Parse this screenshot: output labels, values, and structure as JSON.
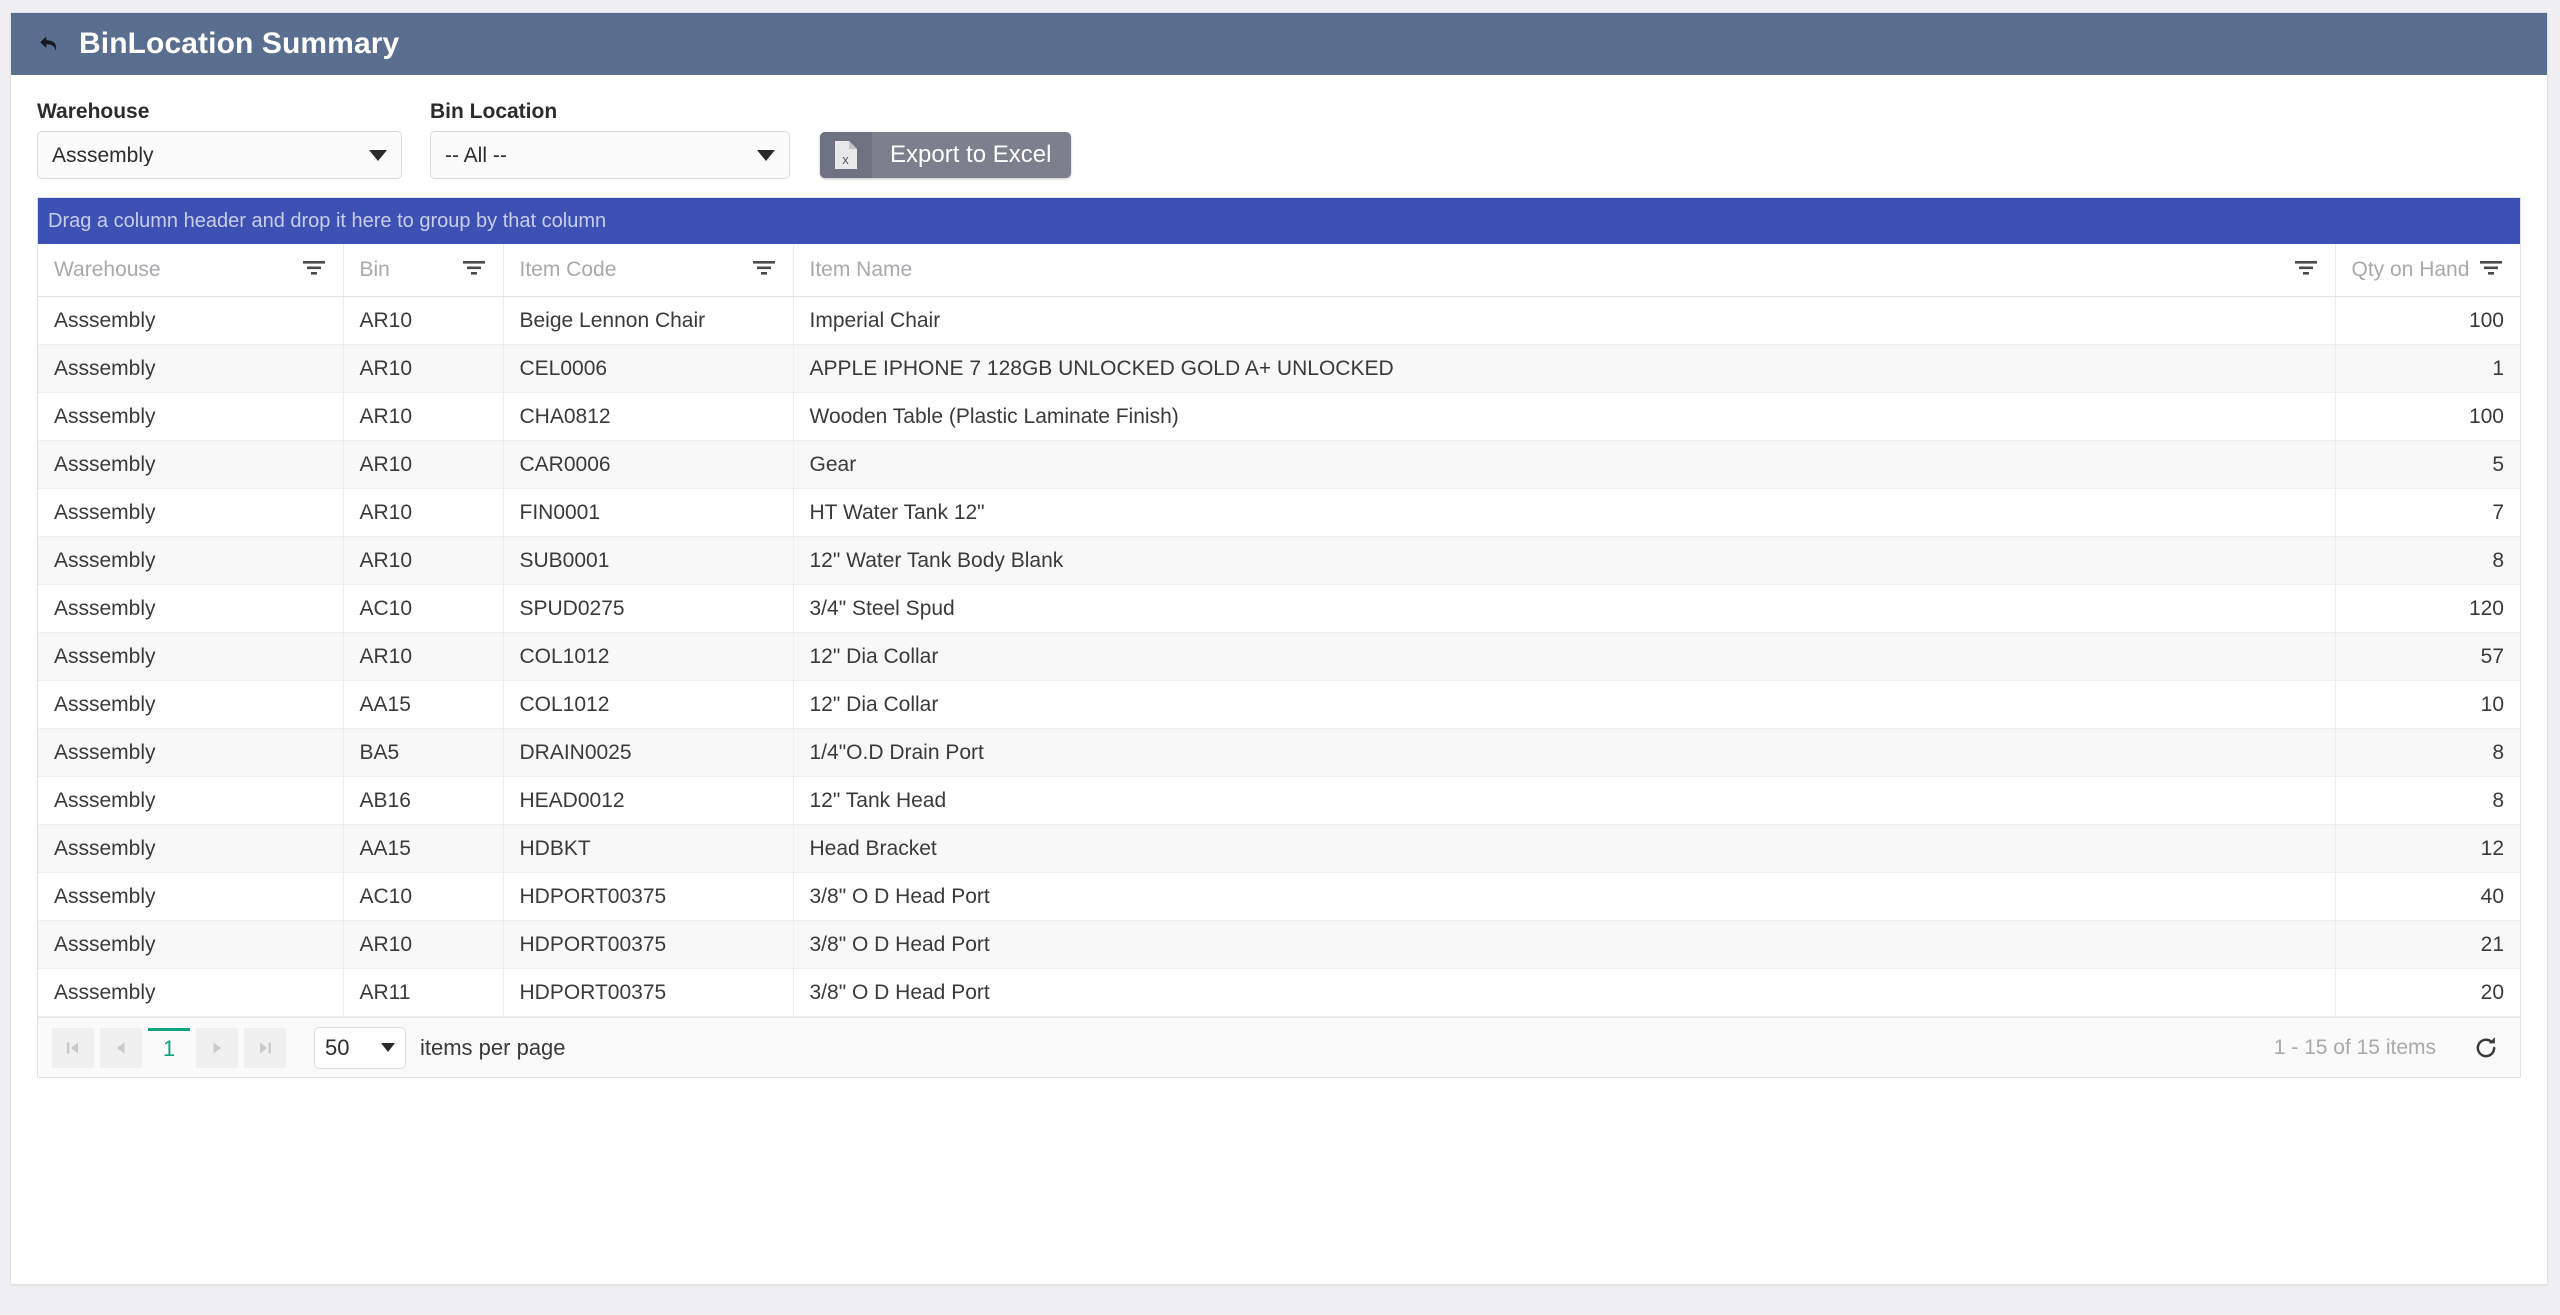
{
  "header": {
    "title": "BinLocation Summary",
    "back_icon": "back-arrow-icon",
    "bg_color": "#5a6e8f"
  },
  "toolbar": {
    "warehouse_label": "Warehouse",
    "warehouse_value": "Asssembly",
    "binlocation_label": "Bin Location",
    "binlocation_value": "-- All --",
    "export_label": "Export to Excel",
    "export_icon": "excel-file-icon",
    "export_bg_color": "#7c7f8c"
  },
  "grid": {
    "group_bar_text": "Drag a column header and drop it here to group by that column",
    "group_bar_color": "#3d51b5",
    "columns": [
      {
        "label": "Warehouse",
        "align": "left",
        "filter": true
      },
      {
        "label": "Bin",
        "align": "left",
        "filter": true
      },
      {
        "label": "Item Code",
        "align": "left",
        "filter": true
      },
      {
        "label": "Item Name",
        "align": "left",
        "filter": true
      },
      {
        "label": "Qty on Hand",
        "align": "right",
        "filter": true
      }
    ],
    "rows": [
      {
        "warehouse": "Asssembly",
        "bin": "AR10",
        "code": "Beige Lennon Chair",
        "name": "Imperial Chair",
        "qty": "100"
      },
      {
        "warehouse": "Asssembly",
        "bin": "AR10",
        "code": "CEL0006",
        "name": "APPLE IPHONE 7 128GB UNLOCKED GOLD A+ UNLOCKED",
        "qty": "1"
      },
      {
        "warehouse": "Asssembly",
        "bin": "AR10",
        "code": "CHA0812",
        "name": "Wooden Table (Plastic Laminate Finish)",
        "qty": "100"
      },
      {
        "warehouse": "Asssembly",
        "bin": "AR10",
        "code": "CAR0006",
        "name": "Gear",
        "qty": "5"
      },
      {
        "warehouse": "Asssembly",
        "bin": "AR10",
        "code": "FIN0001",
        "name": "HT Water Tank 12\"",
        "qty": "7"
      },
      {
        "warehouse": "Asssembly",
        "bin": "AR10",
        "code": "SUB0001",
        "name": "12\" Water Tank Body Blank",
        "qty": "8"
      },
      {
        "warehouse": "Asssembly",
        "bin": "AC10",
        "code": "SPUD0275",
        "name": "3/4\" Steel Spud",
        "qty": "120"
      },
      {
        "warehouse": "Asssembly",
        "bin": "AR10",
        "code": "COL1012",
        "name": "12\" Dia Collar",
        "qty": "57"
      },
      {
        "warehouse": "Asssembly",
        "bin": "AA15",
        "code": "COL1012",
        "name": "12\" Dia Collar",
        "qty": "10"
      },
      {
        "warehouse": "Asssembly",
        "bin": "BA5",
        "code": "DRAIN0025",
        "name": "1/4\"O.D Drain Port",
        "qty": "8"
      },
      {
        "warehouse": "Asssembly",
        "bin": "AB16",
        "code": "HEAD0012",
        "name": "12\" Tank Head",
        "qty": "8"
      },
      {
        "warehouse": "Asssembly",
        "bin": "AA15",
        "code": "HDBKT",
        "name": "Head Bracket",
        "qty": "12"
      },
      {
        "warehouse": "Asssembly",
        "bin": "AC10",
        "code": "HDPORT00375",
        "name": "3/8\" O D Head Port",
        "qty": "40"
      },
      {
        "warehouse": "Asssembly",
        "bin": "AR10",
        "code": "HDPORT00375",
        "name": "3/8\" O D Head Port",
        "qty": "21"
      },
      {
        "warehouse": "Asssembly",
        "bin": "AR11",
        "code": "HDPORT00375",
        "name": "3/8\" O D Head Port",
        "qty": "20"
      }
    ]
  },
  "pager": {
    "first_icon": "first-page-icon",
    "prev_icon": "previous-page-icon",
    "current_page": "1",
    "next_icon": "next-page-icon",
    "last_icon": "last-page-icon",
    "page_size": "50",
    "page_size_label": "items per page",
    "item_count": "1 - 15 of 15 items",
    "refresh_icon": "refresh-icon",
    "active_color": "#0fa47f"
  }
}
